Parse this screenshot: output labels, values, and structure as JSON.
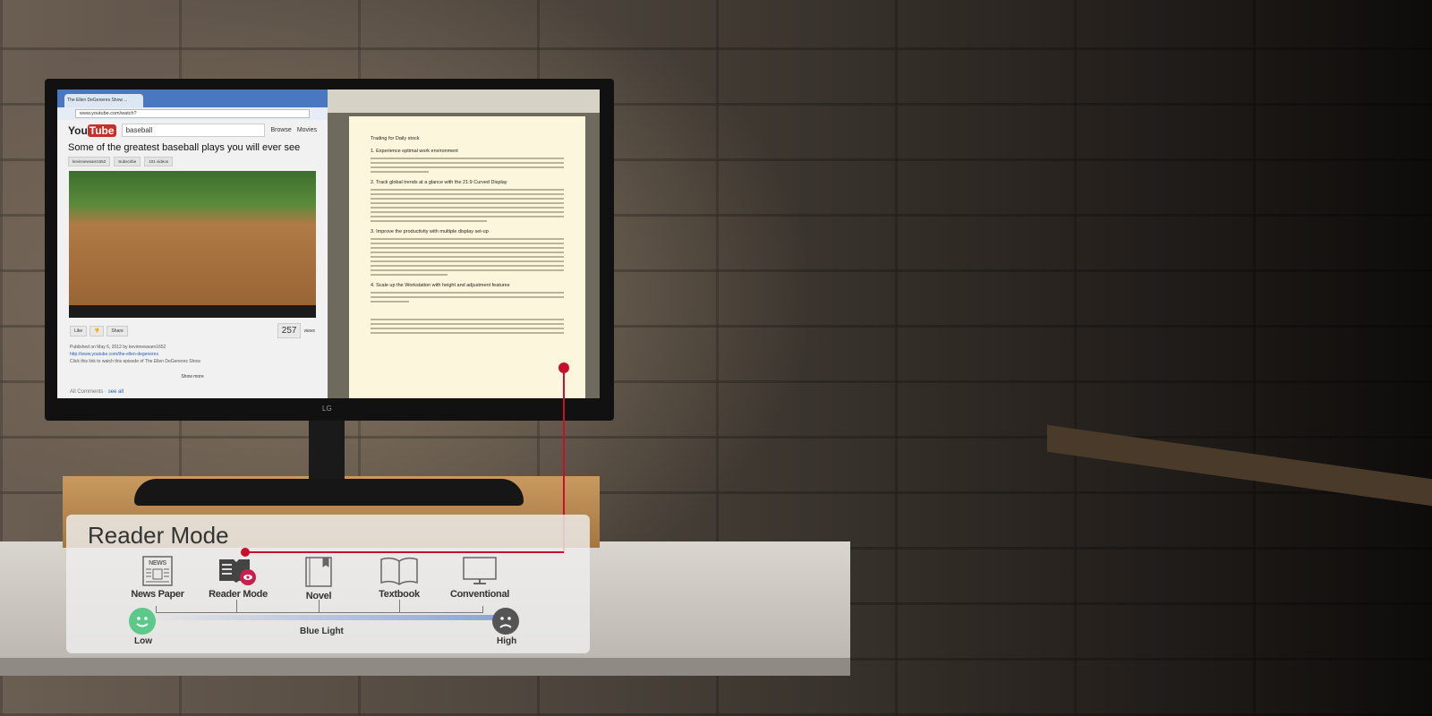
{
  "browser": {
    "tab_title": "The Ellen DeGeneres Show ...",
    "url": "www.youtube.com/watch?",
    "search_value": "baseball",
    "nav": [
      "Browse",
      "Movies"
    ],
    "video_title": "Some of the greatest baseball plays you will ever see",
    "channel": "kevinnewsam1652",
    "subscribe": "Subscribe",
    "videos": "101 videos",
    "like": "Like",
    "share": "Share",
    "views_count": "257",
    "views_label": "views",
    "published": "Published on May 6, 2012 by kevinnewsam1652",
    "link": "http://www.youtube.com/the-ellen-degeneres",
    "description": "Click this link to watch this episode of The Ellen DeGeneres Show",
    "show_more": "Show more",
    "all_comments": "All Comments",
    "see_all": "see all"
  },
  "document": {
    "heading": "Trading for Daily stock",
    "sections": [
      "1. Experience optimal work environment",
      "2. Track global trends at a glance with the 21:9 Curved Display",
      "3. Improve the productivity with multiple display set-up",
      "4. Scale up the Workstation with height and adjustment features"
    ]
  },
  "monitor": {
    "brand": "LG"
  },
  "overlay": {
    "title": "Reader Mode",
    "modes": [
      {
        "label": "News Paper",
        "icon": "newspaper-icon"
      },
      {
        "label": "Reader Mode",
        "icon": "reader-mode-eye-book-icon"
      },
      {
        "label": "Novel",
        "icon": "book-icon"
      },
      {
        "label": "Textbook",
        "icon": "open-book-icon"
      },
      {
        "label": "Conventional",
        "icon": "monitor-icon"
      }
    ],
    "axis_label": "Blue Light",
    "low": "Low",
    "high": "High",
    "low_icon": "smile-face-icon",
    "high_icon": "sad-face-icon",
    "news_icon_text": "NEWS",
    "colors": {
      "accent": "#c8102e",
      "low": "#5cc98a",
      "high": "#555555"
    }
  }
}
